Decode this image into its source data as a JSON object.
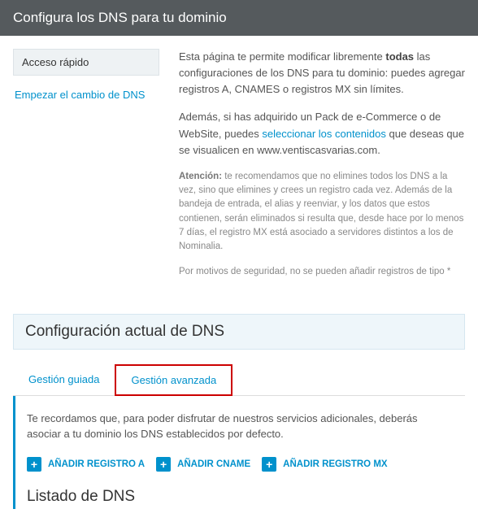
{
  "header": {
    "title": "Configura los DNS para tu dominio"
  },
  "sidebar": {
    "heading": "Acceso rápido",
    "link1": "Empezar el cambio de DNS"
  },
  "intro": {
    "p1_before": "Esta página te permite modificar libremente ",
    "p1_bold": "todas",
    "p1_after": " las configuraciones de los DNS para tu dominio: puedes agregar registros A, CNAMES o registros MX sin límites.",
    "p2_before": "Además, si has adquirido un Pack de e-Commerce o de WebSite, puedes ",
    "p2_link": "seleccionar los contenidos",
    "p2_after": " que deseas que se visualicen en www.ventiscasvarias.com.",
    "note_bold": "Atención:",
    "note_body": " te recomendamos que no elimines todos los DNS a la vez, sino que elimines y crees un registro cada vez. Además de la bandeja de entrada, el alias y reenviar, y los datos que estos contienen, serán eliminados si resulta que, desde hace por lo menos 7 días, el registro MX está asociado a servidores distintos a los de Nominalia.",
    "security_note": "Por motivos de seguridad, no se pueden añadir registros de tipo *"
  },
  "section": {
    "title": "Configuración actual de DNS"
  },
  "tabs": {
    "guided": "Gestión guiada",
    "advanced": "Gestión avanzada"
  },
  "panel": {
    "reminder": "Te recordamos que, para poder disfrutar de nuestros servicios adicionales, deberás asociar a tu dominio los DNS establecidos por defecto.",
    "btn_a": "AÑADIR REGISTRO A",
    "btn_cname": "AÑADIR CNAME",
    "btn_mx": "AÑADIR REGISTRO MX",
    "listing_title": "Listado de DNS"
  }
}
